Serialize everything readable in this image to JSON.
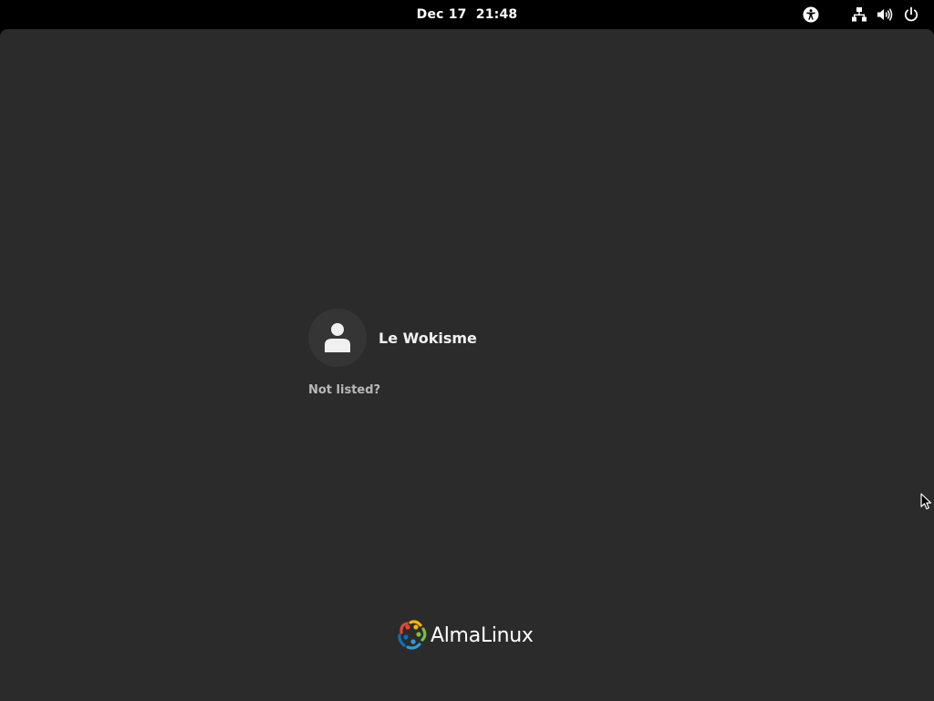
{
  "topbar": {
    "date": "Dec 17",
    "time": "21:48",
    "icons": [
      "accessibility-icon",
      "network-icon",
      "volume-icon",
      "power-icon"
    ]
  },
  "login": {
    "user_name": "Le Wokisme",
    "not_listed_label": "Not listed?"
  },
  "branding": {
    "logo_text": "AlmaLinux"
  },
  "colors": {
    "topbar_bg": "#000000",
    "screen_bg": "#2b2b2b",
    "avatar_bg": "#353535",
    "text_primary": "#f2f2f2",
    "text_secondary": "#b8b8b8"
  }
}
